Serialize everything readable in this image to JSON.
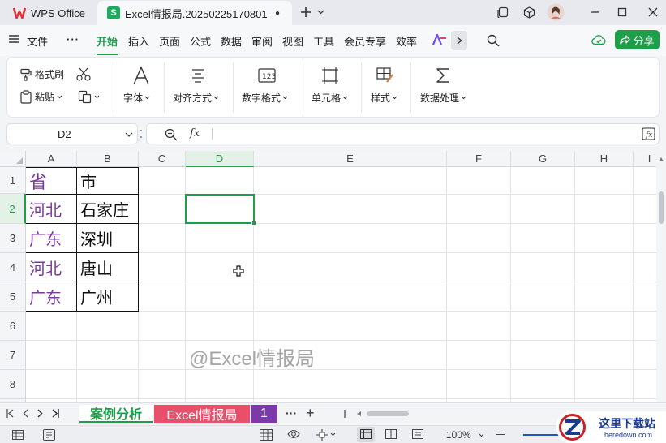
{
  "titlebar": {
    "home_tab": "WPS Office",
    "doc_tab": "Excel情报局.20250225170801",
    "sheet_badge": "S"
  },
  "menubar": {
    "file": "文件",
    "items": [
      "开始",
      "插入",
      "页面",
      "公式",
      "数据",
      "审阅",
      "视图",
      "工具",
      "会员专享",
      "效率"
    ],
    "active": "开始",
    "share": "分享"
  },
  "ribbon": {
    "format_painter": "格式刷",
    "paste": "粘贴",
    "font": "字体",
    "align": "对齐方式",
    "number_format": "数字格式",
    "cell": "单元格",
    "style": "样式",
    "data_process": "数据处理"
  },
  "formula": {
    "cell_ref": "D2",
    "fx": "fx",
    "value": ""
  },
  "grid": {
    "columns": [
      "A",
      "B",
      "C",
      "D",
      "E",
      "F",
      "G",
      "H",
      "I"
    ],
    "rows": [
      "1",
      "2",
      "3",
      "4",
      "5",
      "6",
      "7",
      "8"
    ],
    "selected_col": "D",
    "selected_row": "2",
    "cells": {
      "A1": "省",
      "B1": "市",
      "A2": "河北",
      "B2": "石家庄",
      "A3": "广东",
      "B3": "深圳",
      "A4": "河北",
      "B4": "唐山",
      "A5": "广东",
      "B5": "广州"
    },
    "watermark": "@Excel情报局"
  },
  "sheets": {
    "tabs": [
      "案例分析",
      "Excel情报局",
      "1"
    ],
    "active": "案例分析",
    "more": "···",
    "add": "+"
  },
  "status": {
    "zoom": "100%"
  },
  "site_logo": {
    "name": "这里下载站",
    "url_text": "heredown.com"
  },
  "colors": {
    "accent": "#1f9e4a",
    "province_text": "#7b3a9a",
    "tab_red": "#e8506a",
    "tab_purple": "#7c3aa8"
  }
}
